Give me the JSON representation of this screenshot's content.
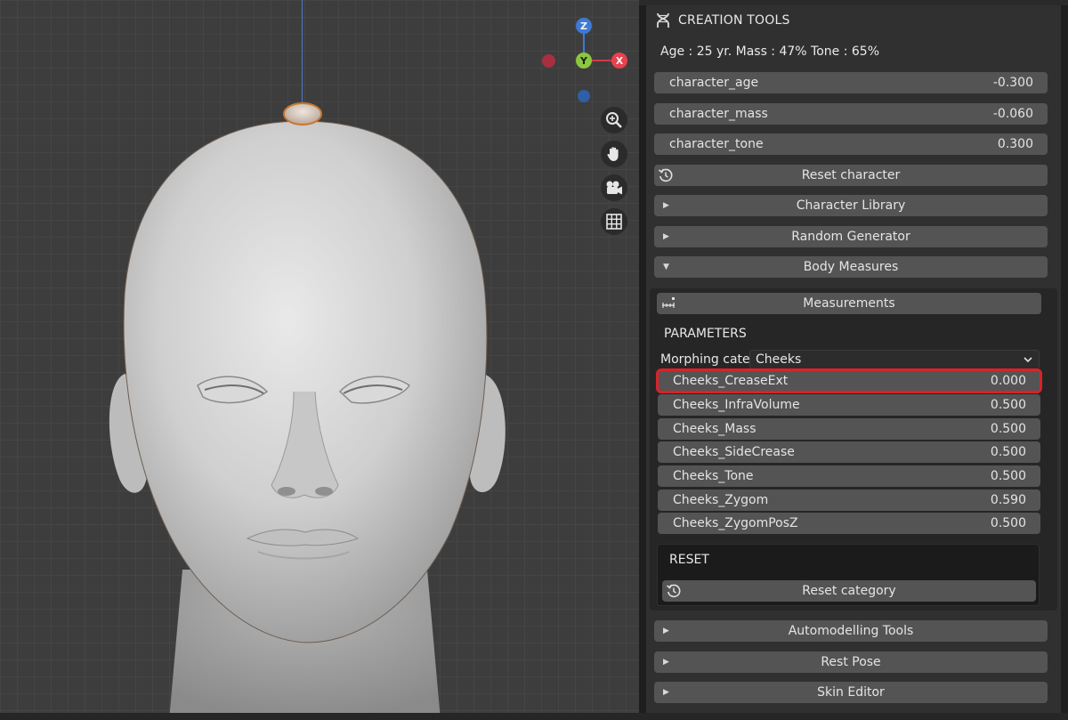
{
  "panel": {
    "title": "CREATION TOOLS",
    "info_line": "Age : 25 yr.  Mass : 47%  Tone : 65%",
    "sliders": [
      {
        "label": "character_age",
        "value": "-0.300"
      },
      {
        "label": "character_mass",
        "value": "-0.060"
      },
      {
        "label": "character_tone",
        "value": "0.300"
      }
    ],
    "reset_character_label": "Reset character",
    "collapsibles_top": [
      {
        "label": "Character Library"
      },
      {
        "label": "Random Generator"
      }
    ],
    "body_measures_label": "Body Measures",
    "measurements_label": "Measurements",
    "parameters_heading": "PARAMETERS",
    "morphing_category_label": "Morphing cate..",
    "morphing_category_value": "Cheeks",
    "cheek_sliders": [
      {
        "label": "Cheeks_CreaseExt",
        "value": "0.000"
      },
      {
        "label": "Cheeks_InfraVolume",
        "value": "0.500"
      },
      {
        "label": "Cheeks_Mass",
        "value": "0.500"
      },
      {
        "label": "Cheeks_SideCrease",
        "value": "0.500"
      },
      {
        "label": "Cheeks_Tone",
        "value": "0.500"
      },
      {
        "label": "Cheeks_Zygom",
        "value": "0.590"
      },
      {
        "label": "Cheeks_ZygomPosZ",
        "value": "0.500"
      }
    ],
    "reset_heading": "RESET",
    "reset_category_label": "Reset category",
    "collapsibles_bottom": [
      {
        "label": "Automodelling Tools"
      },
      {
        "label": "Rest Pose"
      },
      {
        "label": "Skin Editor"
      }
    ]
  },
  "gizmo": {
    "z_label": "Z",
    "y_label": "Y",
    "x_label": "X"
  },
  "colors": {
    "highlight": "#d8232a",
    "x_axis": "#e8414f",
    "y_axis": "#8cc63f",
    "z_axis": "#3d7ad6"
  },
  "nav_icons": [
    "zoom-icon",
    "hand-icon",
    "camera-icon",
    "grid-icon"
  ]
}
